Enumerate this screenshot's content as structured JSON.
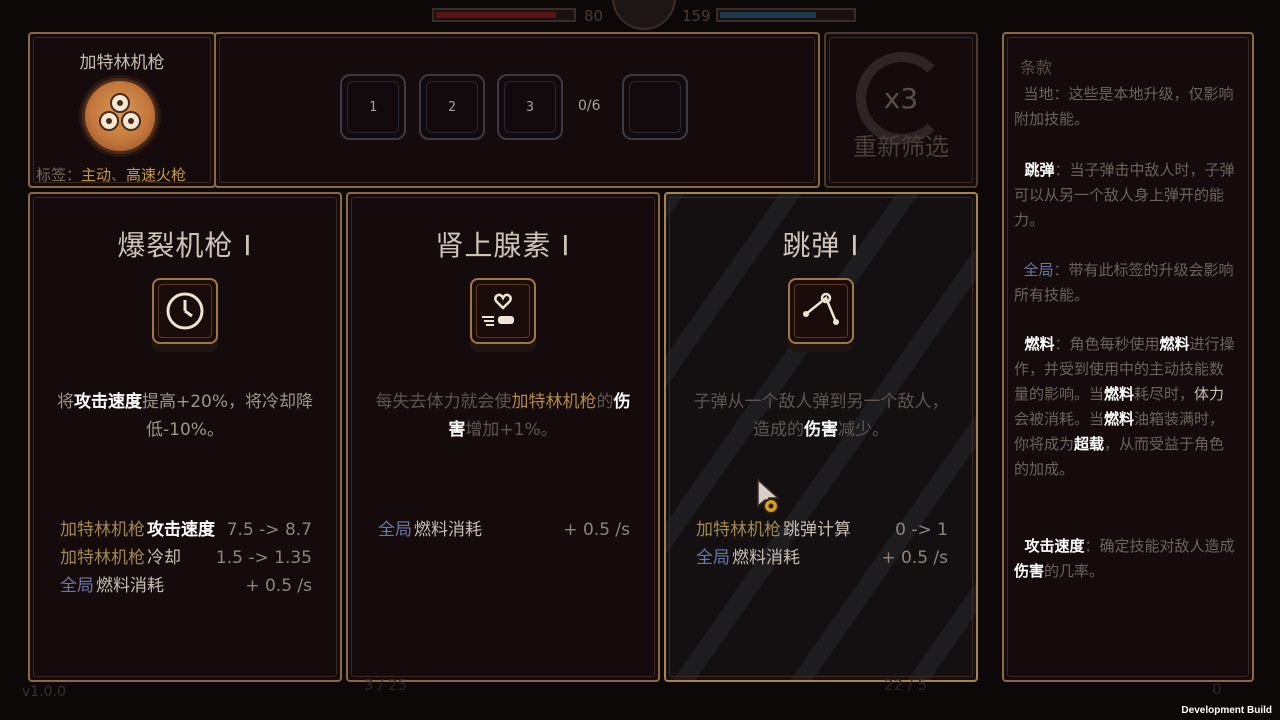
{
  "hud": {
    "hp_value": "80",
    "energy_value": "159",
    "version": "v1.0.0",
    "bottom_left_counter": "3 / 25",
    "bottom_right_counter": "22 / 5",
    "bottom_right_zero": "0",
    "dev_build": "Development Build"
  },
  "weapon": {
    "name": "加特林机枪",
    "tags_label": "标签：",
    "tag_1": "主动",
    "tag_sep": "、",
    "tag_2": "高速火枪",
    "icon": "gatling-coin-icon"
  },
  "slots": {
    "items": [
      "1",
      "2",
      "3"
    ],
    "count": "0/6"
  },
  "reroll": {
    "multiplier": "x3",
    "label": "重新筛选"
  },
  "cards": [
    {
      "title": "爆裂机枪 I",
      "icon": "clock-icon",
      "desc": [
        {
          "t": "将"
        },
        {
          "t": "攻击速度",
          "s": "hl"
        },
        {
          "t": "提高+20%，将冷却降低-10%。"
        }
      ],
      "stats": [
        {
          "scope": "加特林机枪",
          "name": "攻击速度",
          "strong": true,
          "value": "7.5 -> 8.7"
        },
        {
          "scope": "加特林机枪",
          "name": "冷却",
          "strong": false,
          "value": "1.5 -> 1.35"
        },
        {
          "scope": "全局",
          "global": true,
          "name": "燃料消耗",
          "strong": false,
          "value": "+ 0.5 /s"
        }
      ]
    },
    {
      "title": "肾上腺素 I",
      "icon": "heart-bullet-icon",
      "desc": [
        {
          "t": "每失去体力就会使"
        },
        {
          "t": "加特林机枪",
          "s": "hl-gold"
        },
        {
          "t": "的"
        },
        {
          "t": "伤害",
          "s": "hl"
        },
        {
          "t": "增加+1%。"
        }
      ],
      "stats": [
        {
          "scope": "全局",
          "global": true,
          "name": "燃料消耗",
          "strong": false,
          "value": "+ 0.5 /s"
        }
      ]
    },
    {
      "title": "跳弹 I",
      "icon": "ricochet-icon",
      "desc": [
        {
          "t": "子弹从一个敌人弹到另一个敌人，造成的"
        },
        {
          "t": "伤害",
          "s": "hl"
        },
        {
          "t": "减少。"
        }
      ],
      "stats": [
        {
          "scope": "加特林机枪",
          "name": "跳弹计算",
          "strong": false,
          "value": "0 -> 1"
        },
        {
          "scope": "全局",
          "global": true,
          "name": "燃料消耗",
          "strong": false,
          "value": "+ 0.5 /s"
        }
      ]
    }
  ],
  "glossary": {
    "title": "条款",
    "entries": [
      [
        {
          "t": "当地",
          "s": "info-key-dim"
        },
        {
          "t": "：这些是本地升级，仅影响附加技能。"
        }
      ],
      [
        {
          "t": "跳弹",
          "s": "info-key"
        },
        {
          "t": "：当子弹击中敌人时，子弹可以从另一个敌人身上弹开的能力。"
        }
      ],
      [
        {
          "t": "全局",
          "s": "info-key-blue"
        },
        {
          "t": "：带有此标签的升级会影响所有技能。"
        }
      ],
      [
        {
          "t": "燃料",
          "s": "info-key"
        },
        {
          "t": "：角色每秒使用"
        },
        {
          "t": "燃料",
          "s": "info-key"
        },
        {
          "t": "进行操作，并受到使用中的主动技能数量的影响。当"
        },
        {
          "t": "燃料",
          "s": "info-key"
        },
        {
          "t": "耗尽时，"
        },
        {
          "t": "体力",
          "s": "info-w"
        },
        {
          "t": "会被消耗。当"
        },
        {
          "t": "燃料",
          "s": "info-key"
        },
        {
          "t": "油箱装满时，你将成为"
        },
        {
          "t": "超载",
          "s": "info-key"
        },
        {
          "t": "，从而受益于角色的加成。"
        }
      ],
      [
        {
          "t": "攻击速度",
          "s": "info-key"
        },
        {
          "t": "：确定技能对敌人造成"
        },
        {
          "t": "伤害",
          "s": "info-key"
        },
        {
          "t": "的几率。"
        }
      ]
    ]
  },
  "colors": {
    "accent_gold": "#b08a44",
    "global_blue": "#6a78a8",
    "border": "#8a6a44"
  }
}
